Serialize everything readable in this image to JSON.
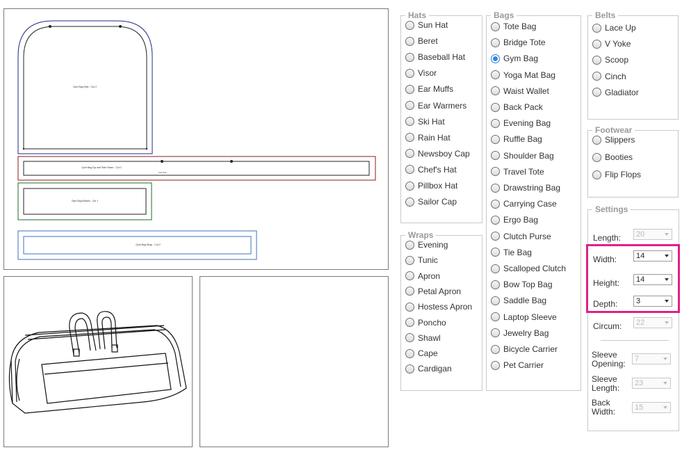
{
  "pattern_labels": {
    "side_panel": "Gym Bag Side - Cut 2",
    "top_panel": "Gym Bag Top and Side Seam - Cut 2",
    "top_panel_note": "fold here",
    "bottom_panel": "Gym Bag Bottom - Cut 1",
    "strap_panel": "Gym Bag Strap - Cut 2"
  },
  "hats": {
    "legend": "Hats",
    "items": [
      "Sun Hat",
      "Beret",
      "Baseball Hat",
      "Visor",
      "Ear Muffs",
      "Ear Warmers",
      "Ski Hat",
      "Rain Hat",
      "Newsboy Cap",
      "Chef's Hat",
      "Pillbox Hat",
      "Sailor Cap"
    ]
  },
  "wraps": {
    "legend": "Wraps",
    "items": [
      "Evening",
      "Tunic",
      "Apron",
      "Petal Apron",
      "Hostess Apron",
      "Poncho",
      "Shawl",
      "Cape",
      "Cardigan"
    ]
  },
  "bags": {
    "legend": "Bags",
    "selected": "Gym Bag",
    "items": [
      "Tote Bag",
      "Bridge Tote",
      "Gym Bag",
      "Yoga Mat Bag",
      "Waist Wallet",
      "Back Pack",
      "Evening Bag",
      "Ruffle Bag",
      "Shoulder Bag",
      "Travel Tote",
      "Drawstring Bag",
      "Carrying Case",
      "Ergo Bag",
      "Clutch Purse",
      "Tie Bag",
      "Scalloped Clutch",
      "Bow Top Bag",
      "Saddle Bag",
      "Laptop Sleeve",
      "Jewelry Bag",
      "Bicycle Carrier",
      "Pet Carrier"
    ]
  },
  "belts": {
    "legend": "Belts",
    "items": [
      "Lace Up",
      "V Yoke",
      "Scoop",
      "Cinch",
      "Gladiator"
    ]
  },
  "footwear": {
    "legend": "Footwear",
    "items": [
      "Slippers",
      "Booties",
      "Flip Flops"
    ]
  },
  "settings": {
    "legend": "Settings",
    "length": {
      "label": "Length:",
      "value": "20",
      "disabled": true
    },
    "width": {
      "label": "Width:",
      "value": "14",
      "disabled": false
    },
    "height": {
      "label": "Height:",
      "value": "14",
      "disabled": false
    },
    "depth": {
      "label": "Depth:",
      "value": "3",
      "disabled": false
    },
    "circum": {
      "label": "Circum:",
      "value": "22",
      "disabled": true
    },
    "sleeve_opening": {
      "label_line1": "Sleeve",
      "label_line2": "Opening:",
      "value": "7",
      "disabled": true
    },
    "sleeve_length": {
      "label_line1": "Sleeve",
      "label_line2": "Length:",
      "value": "23",
      "disabled": true
    },
    "back_width": {
      "label_line1": "Back",
      "label_line2": "Width:",
      "value": "15",
      "disabled": true
    }
  },
  "colors": {
    "side_outline": "#1e2a8c",
    "top_outline": "#8c1a1a",
    "bottom_outline": "#1e6b2a",
    "strap_outline": "#3f6fc0",
    "highlight": "#e0208a"
  }
}
